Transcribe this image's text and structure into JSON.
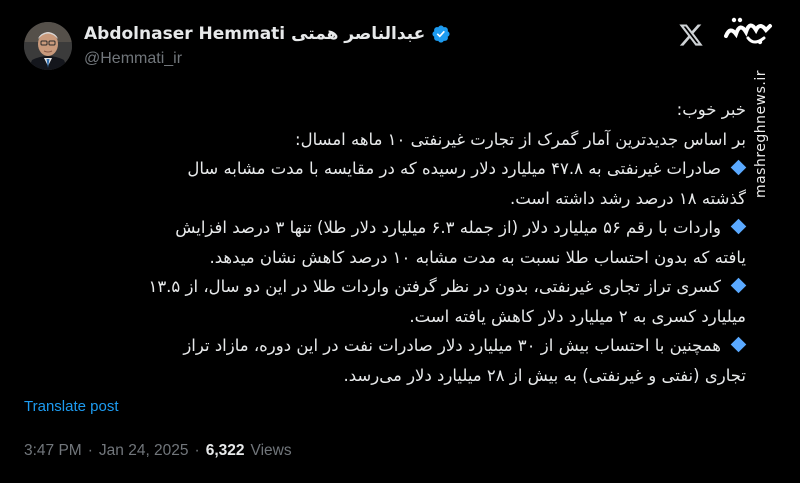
{
  "author": {
    "display_name": "Abdolnaser Hemmati عبدالناصر همتی",
    "handle": "@Hemmati_ir",
    "verified": true,
    "verified_color": "#1d9bf0"
  },
  "tweet": {
    "lines": [
      {
        "bullet": false,
        "text": "خبر خوب:"
      },
      {
        "bullet": false,
        "text": "بر اساس جدیدترین آمار گمرک از تجارت غیرنفتی ۱۰ ماهه امسال:"
      },
      {
        "bullet": true,
        "text": "صادرات غیرنفتی به ۴۷.۸ میلیارد دلار رسیده که در مقایسه با مدت مشابه سال"
      },
      {
        "bullet": false,
        "text": "گذشته ۱۸ درصد رشد داشته است."
      },
      {
        "bullet": true,
        "text": "واردات با رقم ۵۶ میلیارد دلار (از جمله ۶.۳ میلیارد دلار طلا) تنها ۳ درصد افزایش"
      },
      {
        "bullet": false,
        "text": "یافته که بدون احتساب طلا نسبت به مدت مشابه ۱۰ درصد کاهش نشان میدهد."
      },
      {
        "bullet": true,
        "text": "کسری تراز تجاری غیرنفتی، بدون در نظر گرفتن واردات طلا در این دو سال، از ۱۳.۵"
      },
      {
        "bullet": false,
        "text": "میلیارد کسری به ۲ میلیارد دلار کاهش یافته است."
      },
      {
        "bullet": true,
        "text": "همچنین با احتساب بیش از ۳۰ میلیارد دلار صادرات نفت در این دوره، مازاد تراز"
      },
      {
        "bullet": false,
        "text": "تجاری (نفتی و غیرنفتی) به بیش از ۲۸ میلیارد دلار می‌رسد."
      }
    ],
    "bullet_color": "#5aa9ff",
    "translate_label": "Translate post",
    "time": "3:47 PM",
    "separator": "·",
    "date": "Jan 24, 2025",
    "views_count": "6,322",
    "views_label": "Views"
  },
  "watermark": {
    "logo_text": "مشرق",
    "site_text": "mashreghnews.ir"
  },
  "colors": {
    "background": "#000000",
    "text": "#e7e9ea",
    "muted": "#71767b",
    "link": "#1d9bf0"
  }
}
